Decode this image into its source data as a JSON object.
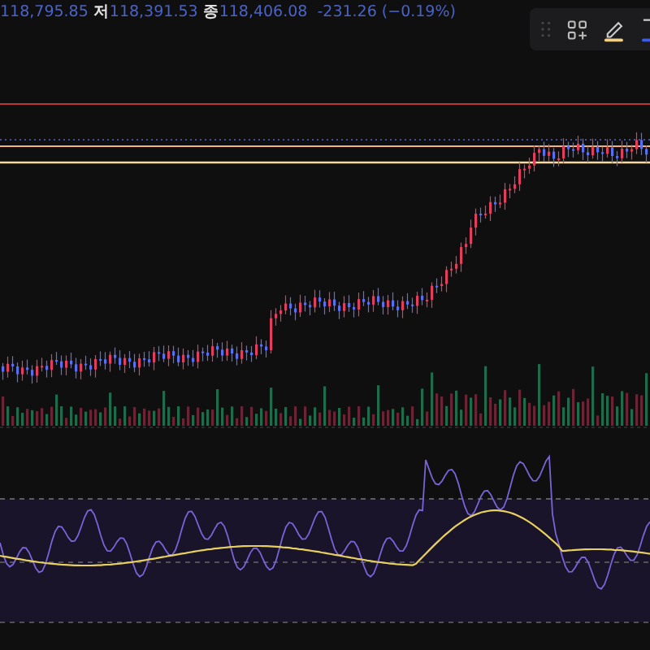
{
  "ohlc": [
    {
      "value": "118,795.85"
    },
    {
      "label": "저",
      "value": "118,391.53"
    },
    {
      "label": "종",
      "value": "118,406.08"
    }
  ],
  "change": "-231.26 (−0.19%)"
}
